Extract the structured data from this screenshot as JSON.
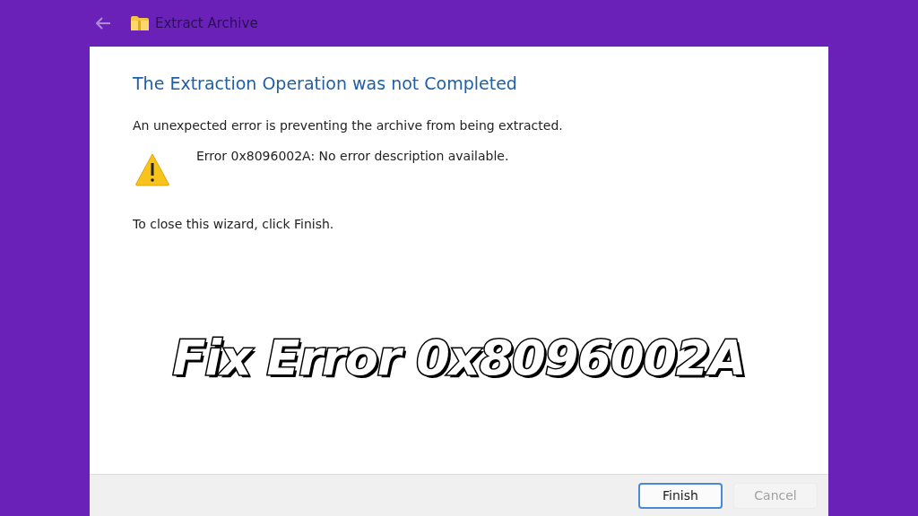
{
  "window": {
    "title": "Extract Archive"
  },
  "heading": "The Extraction Operation was not Completed",
  "message": "An unexpected error is preventing the archive from being extracted.",
  "error": "Error 0x8096002A: No error description available.",
  "instruction": "To close this wizard, click Finish.",
  "buttons": [
    {
      "label": "Finish",
      "default": true,
      "disabled": false
    },
    {
      "label": "Cancel",
      "default": false,
      "disabled": true
    }
  ],
  "overlay_caption": "Fix Error 0x8096002A"
}
